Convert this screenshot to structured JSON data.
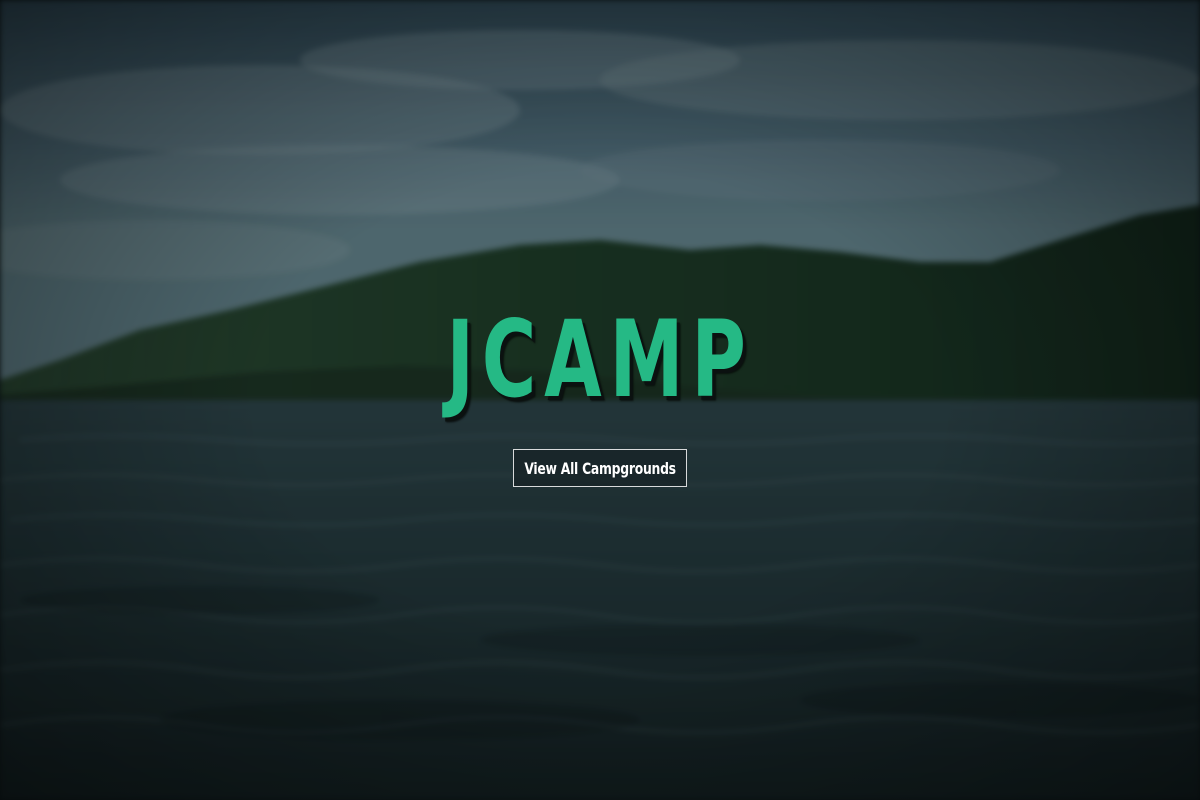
{
  "hero": {
    "title": "JCAMP",
    "cta_label": "View All Campgrounds"
  },
  "colors": {
    "title": "#25b985",
    "title_shadow": "#0b1110",
    "button_border": "#d8dadb",
    "button_text": "#ffffff",
    "sky_top": "#3f5d6d",
    "sky_mid": "#5e7c8a",
    "hills": "#1c3326",
    "water": "#1f3236"
  },
  "background": {
    "description_icon": "blurred-lake-landscape"
  }
}
